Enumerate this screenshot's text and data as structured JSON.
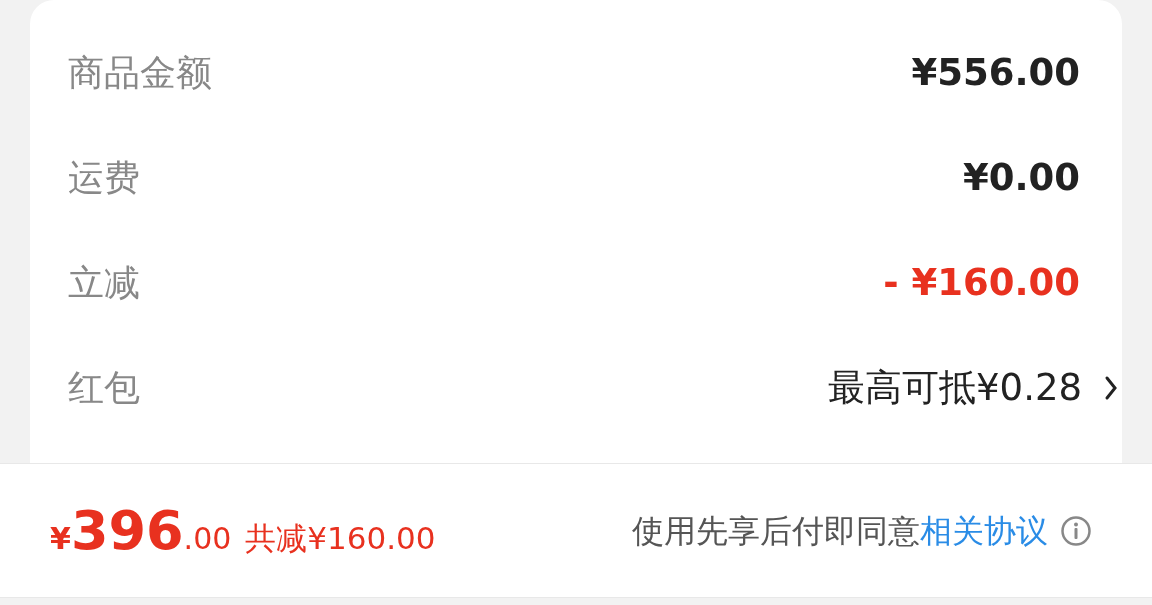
{
  "rows": [
    {
      "label": "商品金额",
      "value": "¥556.00",
      "kind": "plain"
    },
    {
      "label": "运费",
      "value": "¥0.00",
      "kind": "plain"
    },
    {
      "label": "立减",
      "value": "- ¥160.00",
      "kind": "discount"
    },
    {
      "label": "红包",
      "value": "最高可抵¥0.28",
      "kind": "link"
    }
  ],
  "footer": {
    "total": {
      "currency": "¥",
      "integer": "396",
      "decimal": ".00"
    },
    "saving": "共减¥160.00",
    "agreement": "使用先享后付即同意",
    "agreement_link": "相关协议"
  }
}
